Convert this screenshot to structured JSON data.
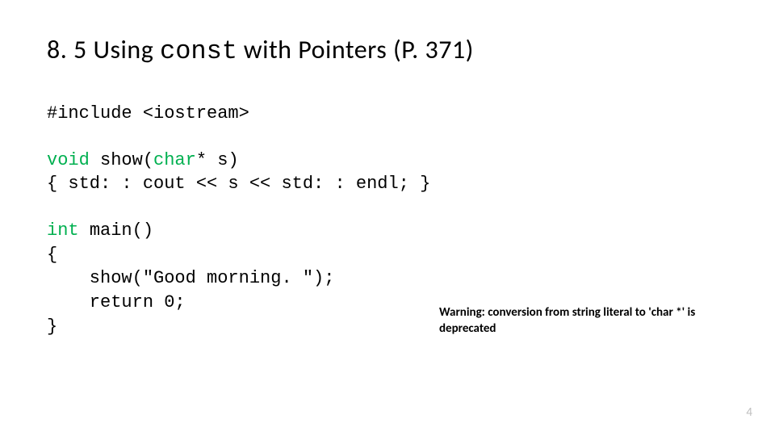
{
  "title": {
    "pre": "8. 5 Using ",
    "mono": "const",
    "post": " with Pointers (P. 371)"
  },
  "code": {
    "include": "#include <iostream>",
    "fn_type": "void ",
    "fn_name": "show(",
    "fn_param_type": "char",
    "fn_param_rest": "* s)",
    "fn_body": "{ std: : cout << s << std: : endl; }",
    "main_type": "int ",
    "main_sig": "main()",
    "main_open": "{",
    "main_call": "    show(\"Good morning. \");",
    "main_return": "    return 0;",
    "main_close": "}"
  },
  "warning": "Warning: conversion from string literal to 'char *' is deprecated",
  "page": "4"
}
